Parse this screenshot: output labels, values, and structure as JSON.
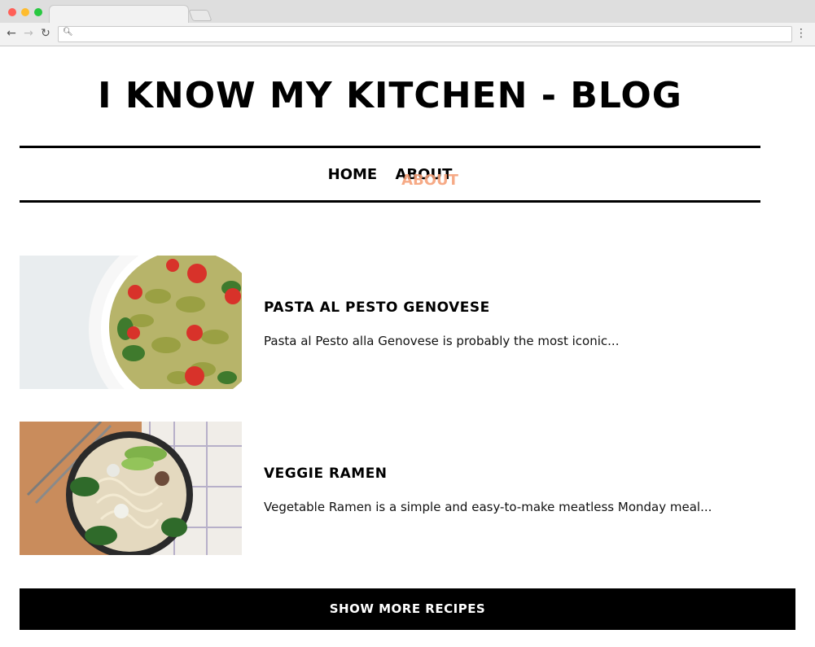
{
  "browser": {
    "tab_title": "",
    "address": "",
    "menu_glyph": "⋮"
  },
  "site": {
    "title": "I KNOW MY KITCHEN - BLOG"
  },
  "nav": {
    "items": [
      {
        "label": "HOME"
      },
      {
        "label": "ABOUT"
      }
    ],
    "hover_label": "ABOUT",
    "hover_color": "#f6a17a"
  },
  "posts": [
    {
      "title": "PASTA AL PESTO GENOVESE",
      "excerpt": "Pasta al Pesto alla Genovese is probably the most iconic..."
    },
    {
      "title": "VEGGIE RAMEN",
      "excerpt": "Vegetable Ramen is a simple and easy-to-make meatless Monday meal..."
    }
  ],
  "actions": {
    "show_more_label": "SHOW MORE RECIPES"
  },
  "colors": {
    "accent": "#000000",
    "hover": "#f6a17a"
  }
}
